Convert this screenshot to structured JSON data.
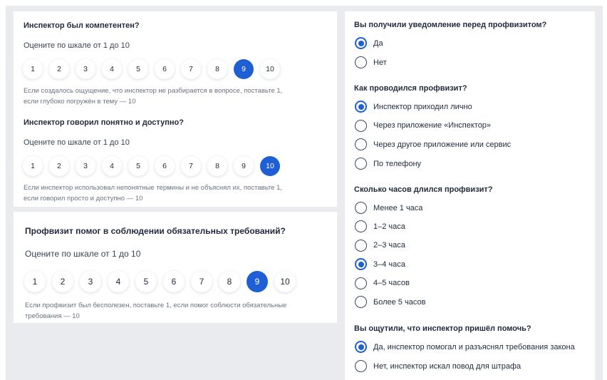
{
  "card1": {
    "q1_title": "Инспектор был компетентен?",
    "q1_sub": "Оцените по шкале от 1 до 10",
    "q1_scale": [
      "1",
      "2",
      "3",
      "4",
      "5",
      "6",
      "7",
      "8",
      "9",
      "10"
    ],
    "q1_selected": "9",
    "q1_hint": "Если создалось ощущение, что инспектор не разбирается в вопросе, поставьте 1, если глубоко погружён в тему — 10",
    "q2_title": "Инспектор говорил понятно и доступно?",
    "q2_sub": "Оцените по шкале от 1 до 10",
    "q2_scale": [
      "1",
      "2",
      "3",
      "4",
      "5",
      "6",
      "7",
      "8",
      "9",
      "10"
    ],
    "q2_selected": "10",
    "q2_hint": "Если инспектор использовал непонятные термины и не объяснял их, поставьте 1, если говорил просто и доступно — 10"
  },
  "card2": {
    "title": "Профвизит помог в соблюдении обязательных требований?",
    "sub": "Оцените по шкале от 1 до 10",
    "scale": [
      "1",
      "2",
      "3",
      "4",
      "5",
      "6",
      "7",
      "8",
      "9",
      "10"
    ],
    "selected": "9",
    "hint": "Если профвизит был бесполезен, поставьте 1, если помог соблюсти обязательные требования — 10"
  },
  "right": {
    "q_notice": {
      "title": "Вы получили уведомление перед профвизитом?",
      "options": [
        "Да",
        "Нет"
      ],
      "selected": "Да"
    },
    "q_how": {
      "title": "Как проводился профвизит?",
      "options": [
        "Инспектор приходил лично",
        "Через приложение «Инспектор»",
        "Через другое приложение или сервис",
        "По телефону"
      ],
      "selected": "Инспектор приходил лично"
    },
    "q_hours": {
      "title": "Сколько часов длился профвизит?",
      "options": [
        "Менее 1 часа",
        "1–2 часа",
        "2–3 часа",
        "3–4 часа",
        "4–5 часов",
        "Более 5 часов"
      ],
      "selected": "3–4 часа"
    },
    "q_help": {
      "title": "Вы ощутили, что инспектор пришёл помочь?",
      "options": [
        "Да, инспектор помогал и разъяснял требования закона",
        "Нет, инспектор искал повод для штрафа"
      ],
      "selected": "Да, инспектор помогал и разъяснял требования закона"
    }
  },
  "colors": {
    "accent": "#1e5fd6",
    "background": "#e9ebee",
    "card": "#ffffff",
    "text": "#1f2a3c",
    "hint": "#6a7282"
  }
}
